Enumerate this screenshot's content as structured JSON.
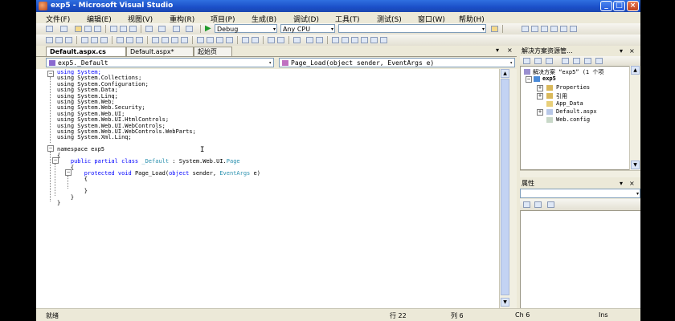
{
  "window": {
    "title": "exp5 - Microsoft Visual Studio",
    "minimize_glyph": "_",
    "maximize_glyph": "□",
    "close_glyph": "×"
  },
  "menu": [
    "文件(F)",
    "编辑(E)",
    "视图(V)",
    "重构(R)",
    "项目(P)",
    "生成(B)",
    "调试(D)",
    "工具(T)",
    "测试(S)",
    "窗口(W)",
    "帮助(H)"
  ],
  "toolbar": {
    "config": "Debug",
    "platform": "Any CPU",
    "run_glyph": "▶",
    "dropdown_glyph": "▾"
  },
  "tabs": [
    {
      "label": "Default.aspx.cs",
      "active": true
    },
    {
      "label": "Default.aspx*",
      "active": false
    },
    {
      "label": "起始页",
      "active": false
    }
  ],
  "tab_controls": {
    "arrow": "▾",
    "close": "×"
  },
  "navbar": {
    "class_combo": "exp5._Default",
    "member_combo": "Page_Load(object sender, EventArgs e)"
  },
  "editor": {
    "using_lines": [
      "using System;",
      "using System.Collections;",
      "using System.Configuration;",
      "using System.Data;",
      "using System.Linq;",
      "using System.Web;",
      "using System.Web.Security;",
      "using System.Web.UI;",
      "using System.Web.UI.HtmlControls;",
      "using System.Web.UI.WebControls;",
      "using System.Web.UI.WebControls.WebParts;",
      "using System.Xml.Linq;"
    ],
    "namespace_line": "namespace exp5",
    "open_brace": "{",
    "class_line_kw": "public partial class ",
    "class_name": "_Default",
    "class_sep": " : ",
    "class_base": "System.Web.UI.",
    "class_base_type": "Page",
    "class_open": "{",
    "method_kw": "protected void ",
    "method_name": "Page_Load(",
    "method_param_kw": "object",
    "method_param": " sender, ",
    "method_param_type": "EventArgs",
    "method_param_end": " e)",
    "method_open": "{",
    "method_close": "}",
    "class_close": "}",
    "ns_close": "}",
    "caret": "I",
    "fold_minus": "−"
  },
  "solution_explorer": {
    "title": "解决方案资源管...",
    "pin": "▾",
    "close": "×",
    "solution_label": "解决方案 “exp5” (1 个项",
    "project": "exp5",
    "items": [
      "Properties",
      "引用",
      "App_Data",
      "Default.aspx",
      "Web.config"
    ],
    "expand_glyph": "+"
  },
  "properties": {
    "title": "属性",
    "pin": "▾",
    "close": "×"
  },
  "scroll": {
    "up": "▲",
    "down": "▼"
  },
  "status": {
    "ready": "就绪",
    "line": "行 22",
    "col": "列 6",
    "ch": "Ch 6",
    "mode": "Ins"
  }
}
